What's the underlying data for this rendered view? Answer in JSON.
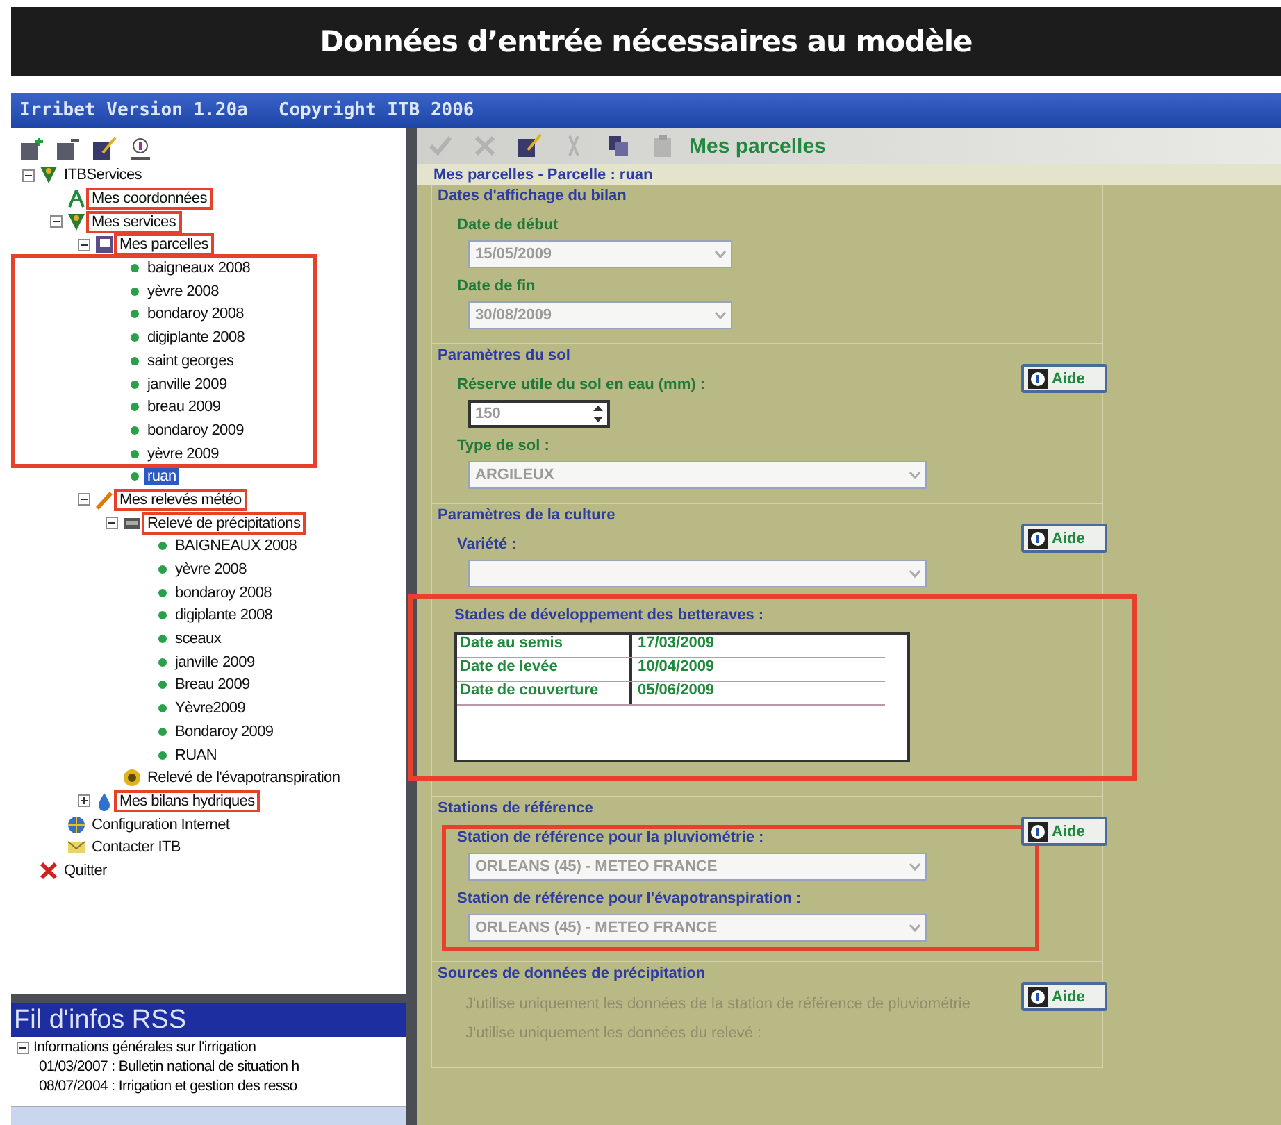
{
  "banner": {
    "title": "Données d’entrée nécessaires au modèle"
  },
  "window": {
    "title": "Irribet Version 1.20a",
    "copyright": "Copyright ITB 2006"
  },
  "left_tools": [
    {
      "kind": "add"
    },
    {
      "kind": "remove"
    },
    {
      "kind": "edit"
    },
    {
      "kind": "info"
    }
  ],
  "tree": [
    {
      "label": "ITBServices",
      "kind": "services",
      "expanded": true,
      "children": [
        {
          "label": "Mes coordonnées",
          "kind": "person",
          "highlighted": true
        },
        {
          "label": "Mes services",
          "kind": "services",
          "highlighted": true,
          "expanded": true,
          "children": [
            {
              "label": "Mes parcelles",
              "kind": "parcels",
              "highlighted": true,
              "expanded": true,
              "children": [
                {
                  "label": "baigneaux 2008",
                  "kind": "leaf",
                  "in_box": true
                },
                {
                  "label": "yèvre 2008",
                  "kind": "leaf",
                  "in_box": true
                },
                {
                  "label": "bondaroy 2008",
                  "kind": "leaf",
                  "in_box": true
                },
                {
                  "label": "digiplante 2008",
                  "kind": "leaf",
                  "in_box": true
                },
                {
                  "label": "saint georges",
                  "kind": "leaf",
                  "in_box": true
                },
                {
                  "label": "janville 2009",
                  "kind": "leaf",
                  "in_box": true
                },
                {
                  "label": "breau 2009",
                  "kind": "leaf",
                  "in_box": true
                },
                {
                  "label": "bondaroy 2009",
                  "kind": "leaf",
                  "in_box": true
                },
                {
                  "label": "yèvre 2009",
                  "kind": "leaf",
                  "in_box": true
                },
                {
                  "label": "ruan",
                  "kind": "leaf",
                  "selected": true
                }
              ]
            },
            {
              "label": "Mes relevés météo",
              "kind": "pencil",
              "highlighted": true,
              "expanded": true,
              "children": [
                {
                  "label": "Relevé de précipitations",
                  "kind": "gauge",
                  "highlighted": true,
                  "expanded": true,
                  "children": [
                    {
                      "label": "BAIGNEAUX 2008",
                      "kind": "leaf"
                    },
                    {
                      "label": "yèvre 2008",
                      "kind": "leaf"
                    },
                    {
                      "label": "bondaroy 2008",
                      "kind": "leaf"
                    },
                    {
                      "label": "digiplante 2008",
                      "kind": "leaf"
                    },
                    {
                      "label": "sceaux",
                      "kind": "leaf"
                    },
                    {
                      "label": "janville 2009",
                      "kind": "leaf"
                    },
                    {
                      "label": "Breau 2009",
                      "kind": "leaf"
                    },
                    {
                      "label": "Yèvre2009",
                      "kind": "leaf"
                    },
                    {
                      "label": "Bondaroy 2009",
                      "kind": "leaf"
                    },
                    {
                      "label": "RUAN",
                      "kind": "leaf"
                    }
                  ]
                },
                {
                  "label": "Relevé de l'évapotranspiration",
                  "kind": "sun"
                }
              ]
            },
            {
              "label": "Mes bilans hydriques",
              "kind": "drop",
              "highlighted": true,
              "expanded": false
            }
          ]
        },
        {
          "label": "Configuration Internet",
          "kind": "network"
        },
        {
          "label": "Contacter ITB",
          "kind": "mail"
        }
      ]
    },
    {
      "label": "Quitter",
      "kind": "quit"
    }
  ],
  "rss": {
    "title": "Fil d'infos RSS",
    "items": [
      {
        "label": "Informations générales sur l'irrigation",
        "expanded": true,
        "children": [
          {
            "label": "01/03/2007 : Bulletin national de situation h"
          },
          {
            "label": "08/07/2004 : Irrigation et gestion des resso"
          }
        ]
      }
    ]
  },
  "toolbar": {
    "title": "Mes parcelles",
    "tools": [
      {
        "kind": "check",
        "disabled": true
      },
      {
        "kind": "cancel",
        "disabled": true
      },
      {
        "kind": "edit",
        "disabled": false
      },
      {
        "kind": "cut",
        "disabled": true
      },
      {
        "kind": "copy",
        "disabled": false
      },
      {
        "kind": "paste",
        "disabled": true
      }
    ]
  },
  "breadcrumb": "Mes parcelles - Parcelle : ruan",
  "sections": [
    {
      "title": "Dates d'affichage du bilan",
      "fields": [
        {
          "kind": "date",
          "label": "Date de début",
          "value": "15/05/2009",
          "color": "#1f7a3a"
        },
        {
          "kind": "date",
          "label": "Date de fin",
          "value": "30/08/2009",
          "color": "#1f7a3a"
        }
      ]
    },
    {
      "title": "Paramètres du sol",
      "help": "Aide",
      "fields": [
        {
          "kind": "spin",
          "label": "Réserve utile du sol en eau (mm) :",
          "value": "150",
          "color": "#1f7a3a"
        },
        {
          "kind": "select",
          "label": "Type de sol :",
          "value": "ARGILEUX",
          "color": "#1f7a3a"
        }
      ]
    },
    {
      "title": "Paramètres de la culture",
      "help": "Aide",
      "fields": [
        {
          "kind": "select",
          "label": "Variété :",
          "color": "#2d3ca0"
        },
        {
          "kind": "stages",
          "label": "Stades de développement des betteraves :",
          "highlighted": true,
          "rows": [
            {
              "name": "Date au semis",
              "date": "17/03/2009"
            },
            {
              "name": "Date de levée",
              "date": "10/04/2009"
            },
            {
              "name": "Date de couverture",
              "date": "05/06/2009"
            }
          ]
        }
      ]
    },
    {
      "title": "Stations de référence",
      "help": "Aide",
      "fields_highlighted": true,
      "fields": [
        {
          "kind": "select",
          "label": "Station de référence pour la pluviométrie :",
          "value": "ORLEANS (45) - METEO FRANCE",
          "color": "#2d3ca0"
        },
        {
          "kind": "select",
          "label": "Station de référence pour l'évapotranspiration :",
          "value": "ORLEANS (45) - METEO FRANCE",
          "color": "#2d3ca0"
        }
      ]
    },
    {
      "title": "Sources de données de précipitation",
      "help": "Aide",
      "fields": [
        {
          "kind": "option",
          "label": "J'utilise uniquement les données de la station de référence de pluviométrie",
          "disabled": true
        },
        {
          "kind": "option",
          "label": "J'utilise uniquement les données du relevé :",
          "disabled": true
        }
      ]
    }
  ]
}
